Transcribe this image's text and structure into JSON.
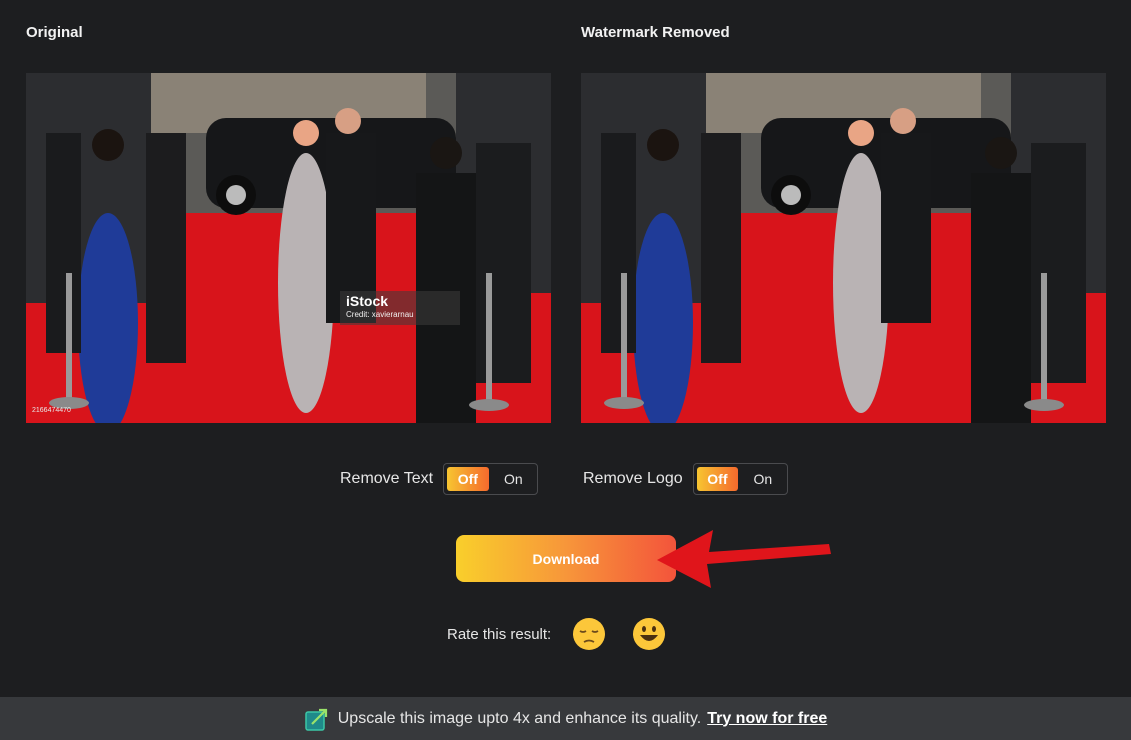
{
  "panels": {
    "original": {
      "title": "Original"
    },
    "cleaned": {
      "title": "Watermark Removed"
    }
  },
  "watermark": {
    "logo": "iStock",
    "credit": "Credit: xavierarnau",
    "image_id": "2166474470"
  },
  "toggles": {
    "remove_text": {
      "label": "Remove Text",
      "off": "Off",
      "on": "On",
      "selected": "Off"
    },
    "remove_logo": {
      "label": "Remove Logo",
      "off": "Off",
      "on": "On",
      "selected": "Off"
    }
  },
  "actions": {
    "download": "Download"
  },
  "rating": {
    "label": "Rate this result:",
    "options": [
      "sad-face-icon",
      "smiley-face-icon"
    ]
  },
  "footer": {
    "text": "Upscale this image upto 4x and enhance its quality.",
    "link": "Try now for free"
  },
  "colors": {
    "accent_start": "#f9cf2b",
    "accent_end": "#f3543b",
    "background": "#1d1e20",
    "footer_bg": "#37393c",
    "arrow": "#e0151b"
  }
}
